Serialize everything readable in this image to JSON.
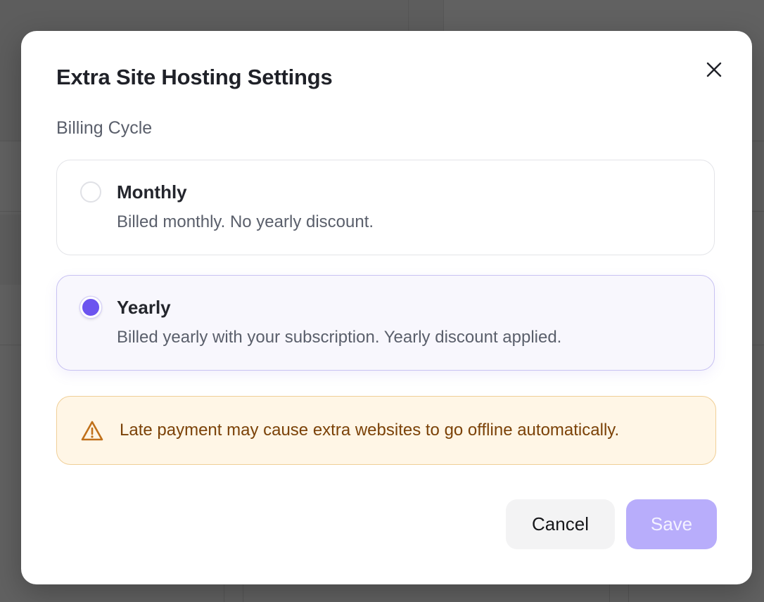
{
  "modal": {
    "title": "Extra Site Hosting Settings",
    "close_icon": "close-icon",
    "billing_label": "Billing Cycle",
    "options": [
      {
        "title": "Monthly",
        "description": "Billed monthly. No yearly discount.",
        "selected": false
      },
      {
        "title": "Yearly",
        "description": "Billed yearly with your subscription. Yearly discount applied.",
        "selected": true
      }
    ],
    "warning": {
      "icon": "warning-triangle-icon",
      "text": "Late payment may cause extra websites to go offline automatically."
    },
    "buttons": {
      "cancel": "Cancel",
      "save": "Save"
    }
  },
  "colors": {
    "accent": "#6c54ef",
    "save_disabled": "#b8adfb",
    "warning_bg": "#fff6e6",
    "warning_border": "#f0cf97",
    "warning_text": "#7b4208"
  }
}
